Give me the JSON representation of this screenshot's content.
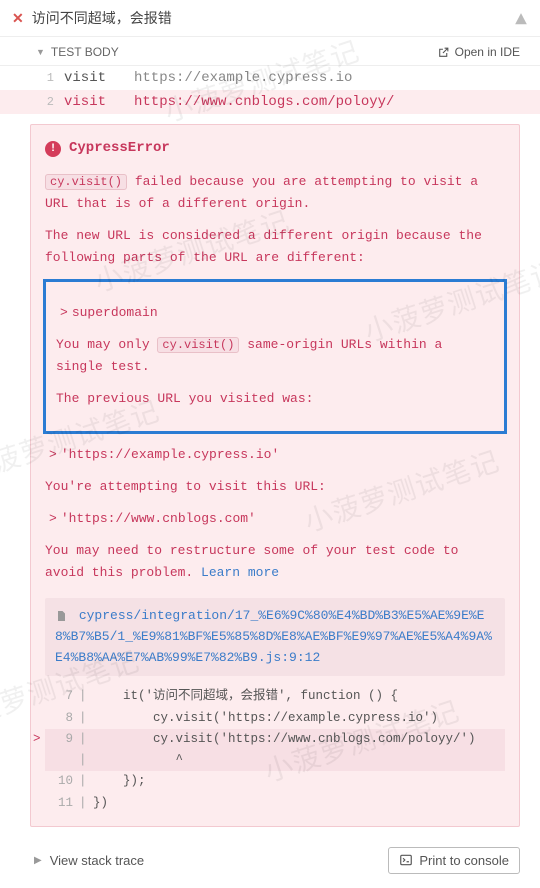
{
  "header": {
    "title": "访问不同超域，会报错"
  },
  "subheader": {
    "label": "TEST BODY",
    "open_ide": "Open in IDE"
  },
  "commands": [
    {
      "num": "1",
      "name": "visit",
      "arg": "https://example.cypress.io",
      "failed": false
    },
    {
      "num": "2",
      "name": "visit",
      "arg": "https://www.cnblogs.com/poloyy/",
      "failed": true
    }
  ],
  "error": {
    "title": "CypressError",
    "code_visit": "cy.visit()",
    "p1a": " failed because you are attempting to visit a URL that is of a different origin.",
    "p2": "The new URL is considered a different origin because the following parts of the URL are different:",
    "superdomain": "superdomain",
    "p3a": "You may only ",
    "p3b": " same-origin URLs within a single test.",
    "p4": "The previous URL you visited was:",
    "url1": "'https://example.cypress.io'",
    "p5": "You're attempting to visit this URL:",
    "url2": "'https://www.cnblogs.com'",
    "p6": "You may need to restructure some of your test code to avoid this problem. ",
    "learn": "Learn more",
    "filepath": "cypress/integration/17_%E6%9C%80%E4%BD%B3%E5%AE%9E%E8%B7%B5/1_%E9%81%BF%E5%85%8D%E8%AE%BF%E9%97%AE%E5%A4%9A%E4%B8%AA%E7%AB%99%E7%82%B9.js:9:12",
    "code": {
      "l7": {
        "n": "7",
        "t": "    it('访问不同超域，会报错', function () {"
      },
      "l8": {
        "n": "8",
        "t": "        cy.visit('https://example.cypress.io')"
      },
      "l9": {
        "n": "9",
        "t": "        cy.visit('https://www.cnblogs.com/poloyy/')"
      },
      "lcaret": {
        "t": "           ^"
      },
      "l10": {
        "n": "10",
        "t": "    });"
      },
      "l11": {
        "n": "11",
        "t": "})"
      }
    }
  },
  "footer": {
    "stack": "View stack trace",
    "print": "Print to console"
  },
  "watermark": "小菠萝测试笔记"
}
